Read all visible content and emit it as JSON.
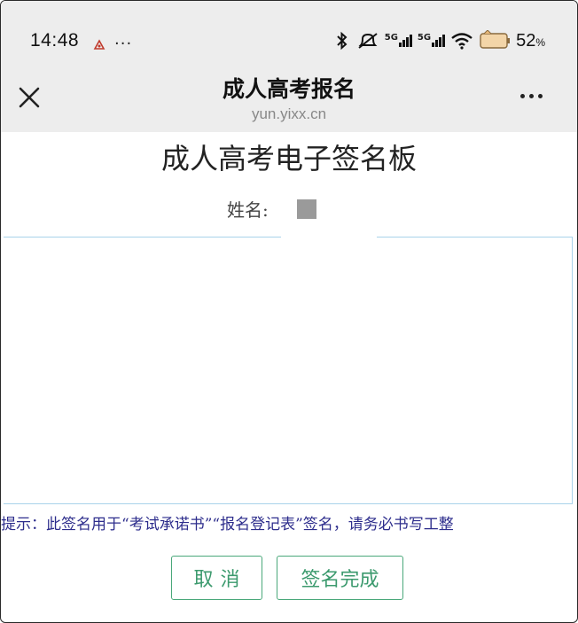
{
  "status_bar": {
    "time": "14:48",
    "more": "···",
    "network_1": "5G",
    "network_2": "5G",
    "battery": "52",
    "battery_unit": "%"
  },
  "nav": {
    "title": "成人高考报名",
    "subtitle": "yun.yixx.cn"
  },
  "page": {
    "title": "成人高考电子签名板",
    "name_label": "姓名:",
    "tip": "提示：此签名用于“考试承诺书”“报名登记表”签名，请务必书写工整",
    "cancel_button": "取消",
    "confirm_button": "签名完成"
  },
  "colors": {
    "accent_green": "#3c9a6e",
    "tip_text": "#2d2d8c",
    "pad_border": "#a8d2ea"
  }
}
